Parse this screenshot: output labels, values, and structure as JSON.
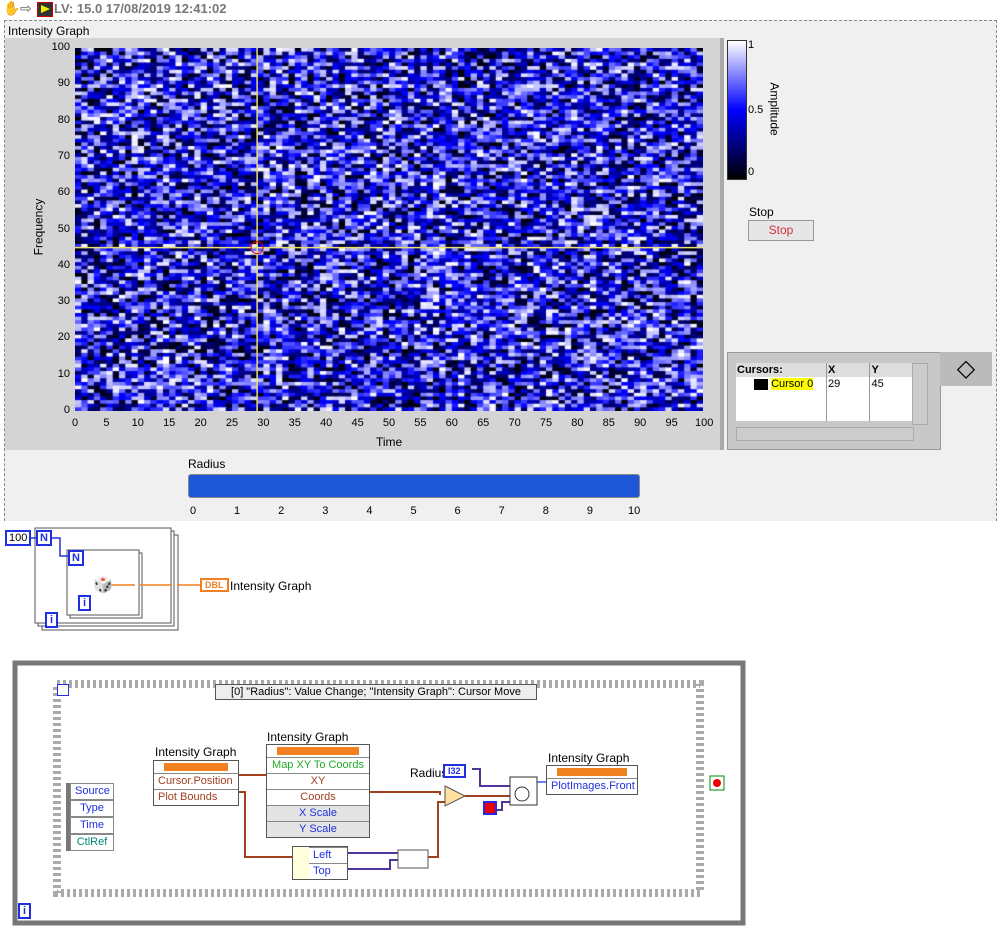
{
  "toolbar": {
    "title": "LV: 15.0 17/08/2019 12:41:02",
    "icons": [
      "hand-icon",
      "arrow-icon",
      "labview-icon"
    ]
  },
  "graph": {
    "label": "Intensity Graph",
    "cursor_position": {
      "x": 29,
      "y": 45
    }
  },
  "chart_data": {
    "type": "heatmap",
    "title": "Intensity Graph",
    "xlabel": "Time",
    "ylabel": "Frequency",
    "zlabel": "Amplitude",
    "xlim": [
      0,
      100
    ],
    "ylim": [
      0,
      100
    ],
    "zlim": [
      0,
      1
    ],
    "xticks": [
      "0",
      "5",
      "10",
      "15",
      "20",
      "25",
      "30",
      "35",
      "40",
      "45",
      "50",
      "55",
      "60",
      "65",
      "70",
      "75",
      "80",
      "85",
      "90",
      "95",
      "100"
    ],
    "yticks": [
      "0",
      "10",
      "20",
      "30",
      "40",
      "50",
      "60",
      "70",
      "80",
      "90",
      "100"
    ],
    "zticks": [
      "0",
      "0.5",
      "1"
    ],
    "colormap": [
      "#000000",
      "#0000ff",
      "#ffffff"
    ],
    "cursor_color": "#e8e070"
  },
  "stop": {
    "label": "Stop",
    "button": "Stop"
  },
  "cursors": {
    "headers": [
      "Cursors:",
      "X",
      "Y"
    ],
    "rows": [
      {
        "name": "Cursor 0",
        "x": "29",
        "y": "45"
      }
    ]
  },
  "radius": {
    "label": "Radius",
    "value": 10,
    "ticks": [
      "0",
      "1",
      "2",
      "3",
      "4",
      "5",
      "6",
      "7",
      "8",
      "9",
      "10"
    ]
  },
  "diagram": {
    "n_const": "100",
    "n": "N",
    "i": "i",
    "dbl": "DBL",
    "graph_term": "Intensity Graph",
    "event_case": "[0] \"Radius\": Value Change;  \"Intensity Graph\": Cursor Move",
    "event_data": [
      "Source",
      "Type",
      "Time",
      "CtlRef"
    ],
    "prop1": {
      "label": "Intensity Graph",
      "items": [
        "Cursor.Position",
        "Plot Bounds"
      ]
    },
    "invoke": {
      "label": "Intensity Graph",
      "items": [
        "Map XY To Coords",
        "XY",
        "Coords",
        "X Scale",
        "Y Scale"
      ]
    },
    "unbundle": [
      "Left",
      "Top"
    ],
    "radius_label": "Radius",
    "i32": "I32",
    "prop2": {
      "label": "Intensity Graph",
      "items": [
        "PlotImages.Front"
      ]
    },
    "loop_i": "i"
  }
}
